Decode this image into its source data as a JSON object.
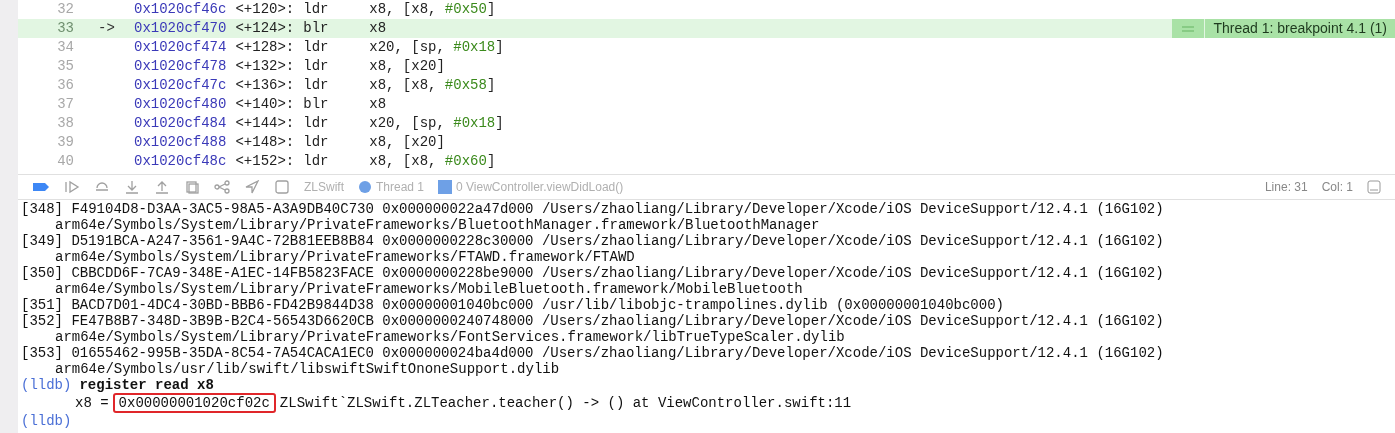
{
  "disassembly": {
    "current_marker": "->",
    "breakpoint_badge": "Thread 1: breakpoint 4.1 (1)",
    "rows": [
      {
        "line": "32",
        "current": false,
        "address": "0x1020cf46c",
        "offset": "<+120>:",
        "mnemonic": "ldr",
        "operands": [
          {
            "kind": "reg",
            "text": "x8, [x8, "
          },
          {
            "kind": "imm",
            "text": "#0x50"
          },
          {
            "kind": "reg",
            "text": "]"
          }
        ]
      },
      {
        "line": "33",
        "current": true,
        "address": "0x1020cf470",
        "offset": "<+124>:",
        "mnemonic": "blr",
        "operands": [
          {
            "kind": "reg",
            "text": "x8"
          }
        ]
      },
      {
        "line": "34",
        "current": false,
        "address": "0x1020cf474",
        "offset": "<+128>:",
        "mnemonic": "ldr",
        "operands": [
          {
            "kind": "reg",
            "text": "x20, [sp, "
          },
          {
            "kind": "imm",
            "text": "#0x18"
          },
          {
            "kind": "reg",
            "text": "]"
          }
        ]
      },
      {
        "line": "35",
        "current": false,
        "address": "0x1020cf478",
        "offset": "<+132>:",
        "mnemonic": "ldr",
        "operands": [
          {
            "kind": "reg",
            "text": "x8, [x20]"
          }
        ]
      },
      {
        "line": "36",
        "current": false,
        "address": "0x1020cf47c",
        "offset": "<+136>:",
        "mnemonic": "ldr",
        "operands": [
          {
            "kind": "reg",
            "text": "x8, [x8, "
          },
          {
            "kind": "imm",
            "text": "#0x58"
          },
          {
            "kind": "reg",
            "text": "]"
          }
        ]
      },
      {
        "line": "37",
        "current": false,
        "address": "0x1020cf480",
        "offset": "<+140>:",
        "mnemonic": "blr",
        "operands": [
          {
            "kind": "reg",
            "text": "x8"
          }
        ]
      },
      {
        "line": "38",
        "current": false,
        "address": "0x1020cf484",
        "offset": "<+144>:",
        "mnemonic": "ldr",
        "operands": [
          {
            "kind": "reg",
            "text": "x20, [sp, "
          },
          {
            "kind": "imm",
            "text": "#0x18"
          },
          {
            "kind": "reg",
            "text": "]"
          }
        ]
      },
      {
        "line": "39",
        "current": false,
        "address": "0x1020cf488",
        "offset": "<+148>:",
        "mnemonic": "ldr",
        "operands": [
          {
            "kind": "reg",
            "text": "x8, [x20]"
          }
        ]
      },
      {
        "line": "40",
        "current": false,
        "address": "0x1020cf48c",
        "offset": "<+152>:",
        "mnemonic": "ldr",
        "operands": [
          {
            "kind": "reg",
            "text": "x8, [x8, "
          },
          {
            "kind": "imm",
            "text": "#0x60"
          },
          {
            "kind": "reg",
            "text": "]"
          }
        ]
      }
    ]
  },
  "debug_bar": {
    "breadcrumbs": [
      "ZLSwift",
      "Thread 1",
      "0 ViewController.viewDidLoad()"
    ],
    "line": "Line: 31",
    "col": "Col: 1"
  },
  "console": {
    "lines": [
      {
        "kind": "entry",
        "text": "[348] F49104D8-D3AA-3AC5-98A5-A3A9DB40C730 0x000000022a47d000 /Users/zhaoliang/Library/Developer/Xcode/iOS DeviceSupport/12.4.1 (16G102)"
      },
      {
        "kind": "continuation",
        "text": "arm64e/Symbols/System/Library/PrivateFrameworks/BluetoothManager.framework/BluetoothManager"
      },
      {
        "kind": "entry",
        "text": "[349] D5191BCA-A247-3561-9A4C-72B81EEB8B84 0x0000000228c30000 /Users/zhaoliang/Library/Developer/Xcode/iOS DeviceSupport/12.4.1 (16G102)"
      },
      {
        "kind": "continuation",
        "text": "arm64e/Symbols/System/Library/PrivateFrameworks/FTAWD.framework/FTAWD"
      },
      {
        "kind": "entry",
        "text": "[350] CBBCDD6F-7CA9-348E-A1EC-14FB5823FACE 0x0000000228be9000 /Users/zhaoliang/Library/Developer/Xcode/iOS DeviceSupport/12.4.1 (16G102)"
      },
      {
        "kind": "continuation",
        "text": "arm64e/Symbols/System/Library/PrivateFrameworks/MobileBluetooth.framework/MobileBluetooth"
      },
      {
        "kind": "entry",
        "text": "[351] BACD7D01-4DC4-30BD-BBB6-FD42B9844D38 0x00000001040bc000 /usr/lib/libobjc-trampolines.dylib (0x00000001040bc000)"
      },
      {
        "kind": "entry",
        "text": "[352] FE47B8B7-348D-3B9B-B2C4-56543D6620CB 0x0000000240748000 /Users/zhaoliang/Library/Developer/Xcode/iOS DeviceSupport/12.4.1 (16G102)"
      },
      {
        "kind": "continuation",
        "text": "arm64e/Symbols/System/Library/PrivateFrameworks/FontServices.framework/libTrueTypeScaler.dylib"
      },
      {
        "kind": "entry",
        "text": "[353] 01655462-995B-35DA-8C54-7A54CACA1EC0 0x000000024ba4d000 /Users/zhaoliang/Library/Developer/Xcode/iOS DeviceSupport/12.4.1 (16G102)"
      },
      {
        "kind": "continuation",
        "text": "arm64e/Symbols/usr/lib/swift/libswiftSwiftOnoneSupport.dylib"
      },
      {
        "kind": "prompt",
        "prompt": "(lldb)",
        "command": "register read x8"
      },
      {
        "kind": "result",
        "label": "x8 =",
        "value": "0x00000001020cf02c",
        "highlighted": true,
        "rest": "ZLSwift`ZLSwift.ZLTeacher.teacher() -> () at ViewController.swift:11"
      },
      {
        "kind": "prompt",
        "prompt": "(lldb)"
      }
    ]
  }
}
